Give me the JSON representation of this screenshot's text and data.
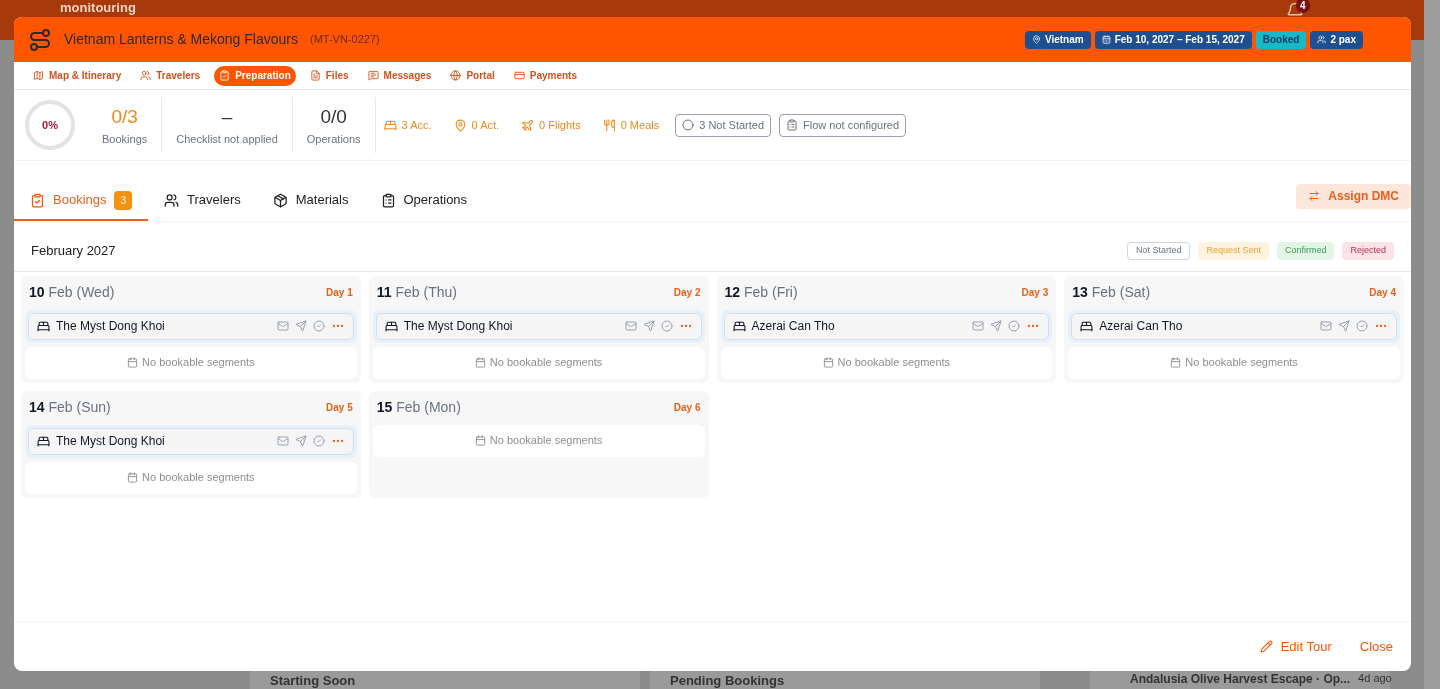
{
  "background": {
    "logo": "monitouring",
    "notification_count": "4",
    "widgets": [
      {
        "title": "Starting Soon"
      },
      {
        "title": "Pending Bookings"
      }
    ],
    "activity": {
      "title": "Andalusia Olive Harvest Escape · Op...",
      "time": "4d ago"
    }
  },
  "modal": {
    "title": "Vietnam Lanterns & Mekong Flavours",
    "code": "(MT-VN-0227)",
    "header_badges": [
      {
        "kind": "location",
        "label": "Vietnam"
      },
      {
        "kind": "dates",
        "label": "Feb 10, 2027 – Feb 15, 2027"
      },
      {
        "kind": "status",
        "label": "Booked"
      },
      {
        "kind": "pax",
        "label": "2 pax"
      }
    ],
    "nav": [
      {
        "kind": "map",
        "label": "Map & Itinerary",
        "selected": false
      },
      {
        "kind": "travelers",
        "label": "Travelers",
        "selected": false
      },
      {
        "kind": "preparation",
        "label": "Preparation",
        "selected": true
      },
      {
        "kind": "files",
        "label": "Files",
        "selected": false
      },
      {
        "kind": "messages",
        "label": "Messages",
        "selected": false
      },
      {
        "kind": "portal",
        "label": "Portal",
        "selected": false
      },
      {
        "kind": "payments",
        "label": "Payments",
        "selected": false
      }
    ],
    "progress": {
      "label": "0%",
      "level": 0
    },
    "stats": [
      {
        "value": "0/3",
        "label": "Bookings",
        "highlight": true
      },
      {
        "value": "–",
        "label": "Checklist not applied",
        "highlight": false
      },
      {
        "value": "0/0",
        "label": "Operations",
        "highlight": false
      }
    ],
    "counts": [
      {
        "kind": "bed",
        "label": "3 Acc."
      },
      {
        "kind": "pin",
        "label": "0 Act."
      },
      {
        "kind": "plane",
        "label": "0 Flights"
      },
      {
        "kind": "meal",
        "label": "0 Meals"
      }
    ],
    "status_chips": [
      {
        "kind": "circle",
        "label": "3 Not Started"
      },
      {
        "kind": "clipboard",
        "label": "Flow not configured"
      }
    ],
    "tabs": [
      {
        "kind": "bookings",
        "label": "Bookings",
        "badge": "3",
        "selected": true
      },
      {
        "kind": "travelers",
        "label": "Travelers",
        "selected": false
      },
      {
        "kind": "materials",
        "label": "Materials",
        "selected": false
      },
      {
        "kind": "operations",
        "label": "Operations",
        "selected": false
      }
    ],
    "assign_button": "Assign DMC",
    "month": "February 2027",
    "legend": [
      {
        "kind": "not_started",
        "label": "Not Started"
      },
      {
        "kind": "request_sent",
        "label": "Request Sent"
      },
      {
        "kind": "confirmed",
        "label": "Confirmed"
      },
      {
        "kind": "rejected",
        "label": "Rejected"
      }
    ],
    "days": [
      {
        "day": "10",
        "month": "Feb",
        "weekday": "(Wed)",
        "day_label": "Day 1",
        "bookings": [
          {
            "name": "The Myst Dong Khoi"
          }
        ],
        "empty_note": "No bookable segments"
      },
      {
        "day": "11",
        "month": "Feb",
        "weekday": "(Thu)",
        "day_label": "Day 2",
        "bookings": [
          {
            "name": "The Myst Dong Khoi"
          }
        ],
        "empty_note": "No bookable segments"
      },
      {
        "day": "12",
        "month": "Feb",
        "weekday": "(Fri)",
        "day_label": "Day 3",
        "bookings": [
          {
            "name": "Azerai Can Tho"
          }
        ],
        "empty_note": "No bookable segments"
      },
      {
        "day": "13",
        "month": "Feb",
        "weekday": "(Sat)",
        "day_label": "Day 4",
        "bookings": [
          {
            "name": "Azerai Can Tho"
          }
        ],
        "empty_note": "No bookable segments"
      },
      {
        "day": "14",
        "month": "Feb",
        "weekday": "(Sun)",
        "day_label": "Day 5",
        "bookings": [
          {
            "name": "The Myst Dong Khoi"
          }
        ],
        "empty_note": "No bookable segments"
      },
      {
        "day": "15",
        "month": "Feb",
        "weekday": "(Mon)",
        "day_label": "Day 6",
        "empty_note": "No bookable segments"
      }
    ],
    "footer_buttons": [
      {
        "kind": "edit",
        "label": "Edit Tour"
      },
      {
        "kind": "close",
        "label": "Close"
      }
    ]
  }
}
